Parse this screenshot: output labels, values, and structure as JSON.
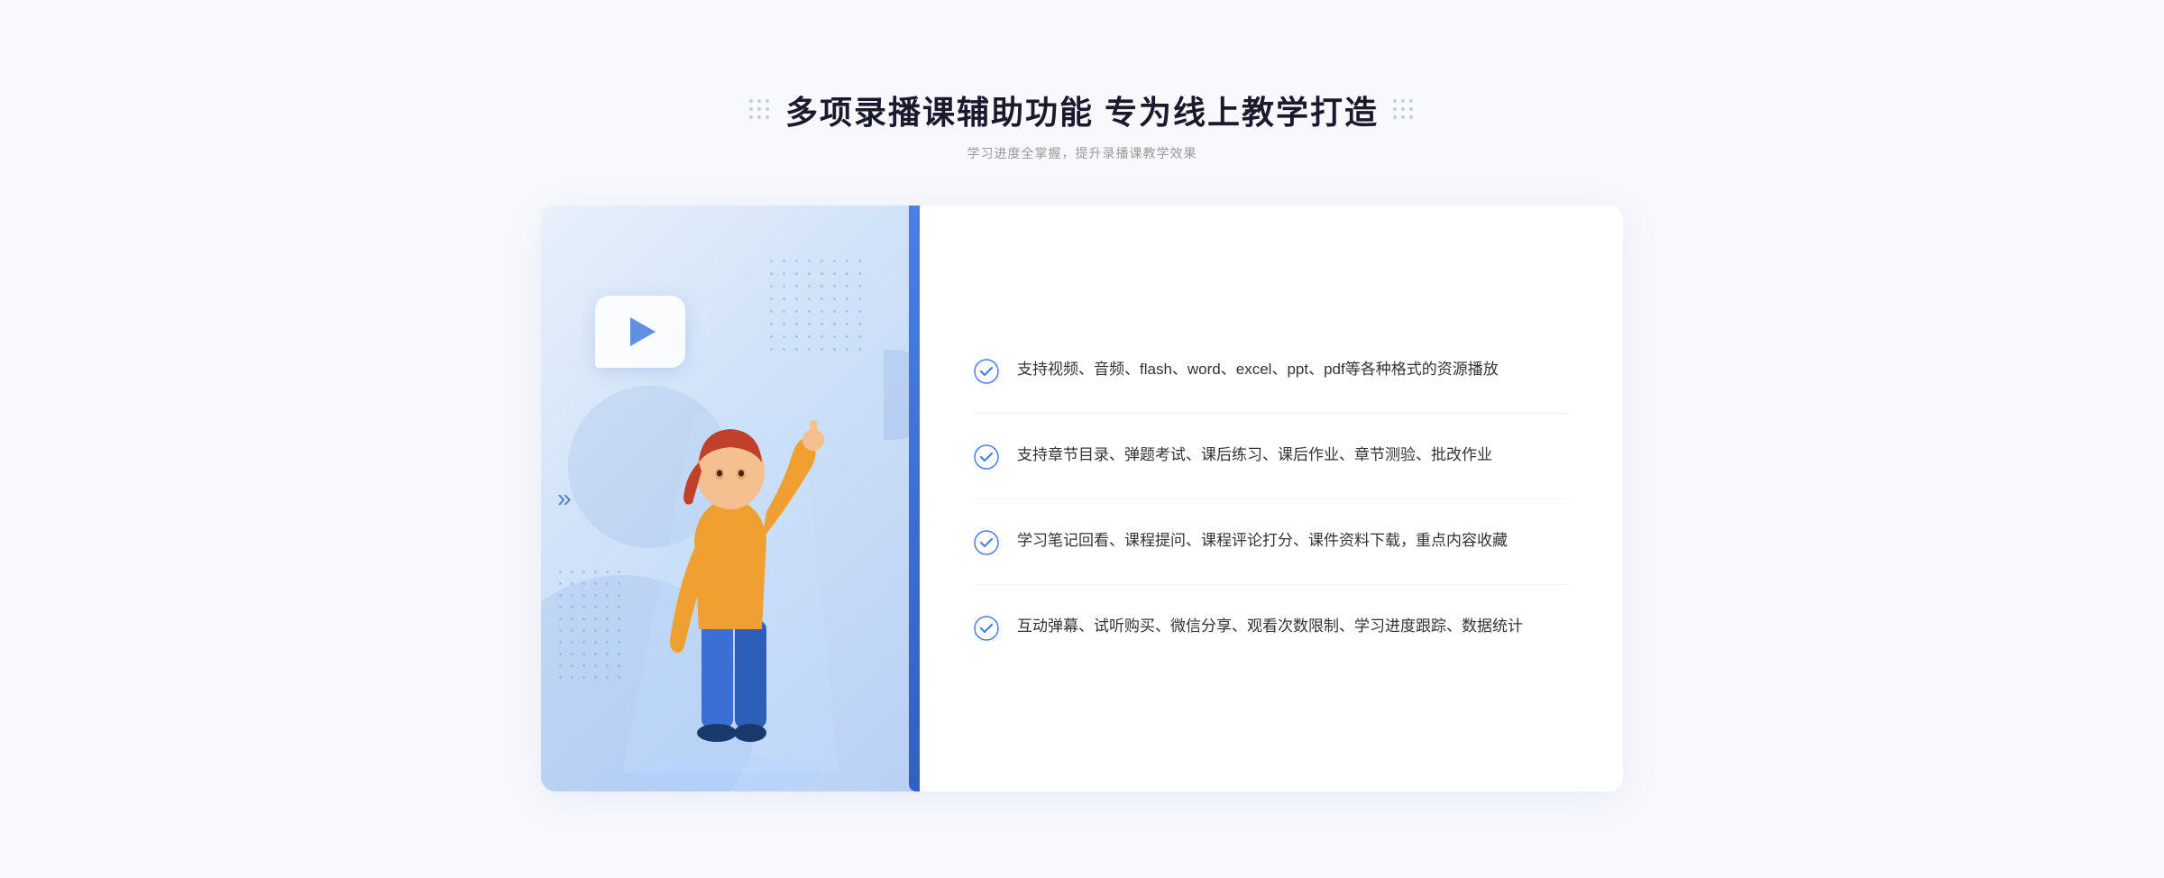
{
  "header": {
    "main_title": "多项录播课辅助功能 专为线上教学打造",
    "sub_title": "学习进度全掌握，提升录播课教学效果"
  },
  "features": [
    {
      "id": "feature-1",
      "text": "支持视频、音频、flash、word、excel、ppt、pdf等各种格式的资源播放"
    },
    {
      "id": "feature-2",
      "text": "支持章节目录、弹题考试、课后练习、课后作业、章节测验、批改作业"
    },
    {
      "id": "feature-3",
      "text": "学习笔记回看、课程提问、课程评论打分、课件资料下载，重点内容收藏"
    },
    {
      "id": "feature-4",
      "text": "互动弹幕、试听购买、微信分享、观看次数限制、学习进度跟踪、数据统计"
    }
  ],
  "colors": {
    "primary": "#4a7fe8",
    "secondary": "#3060c0",
    "check_color": "#4a7fe8",
    "text_main": "#333333",
    "text_sub": "#999999"
  }
}
